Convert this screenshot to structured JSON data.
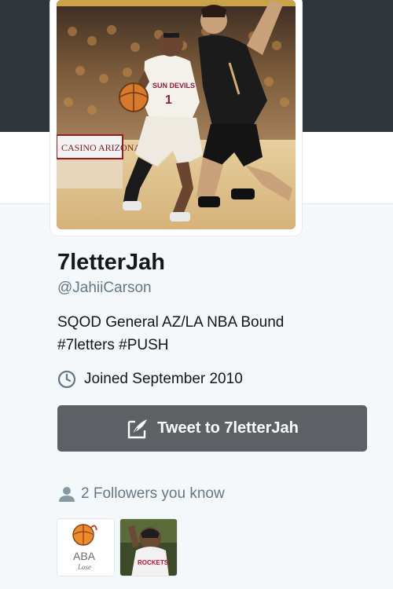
{
  "profile": {
    "name": "7letterJah",
    "handle": "@JahiiCarson",
    "bio_lines": [
      "SQOD General AZ/LA NBA Bound",
      "#7letters #PUSH"
    ],
    "joined": "Joined September 2010"
  },
  "avatar": {
    "jersey_text": "SUN DEVILS",
    "jersey_number": "1",
    "ad_text": "CASINO ARIZONA"
  },
  "tweet_button": {
    "label": "Tweet to 7letterJah"
  },
  "followers_you_know": {
    "text": "2 Followers you know",
    "items": [
      {
        "logo_text": "ABA",
        "logo_subtext": "Lose"
      },
      {
        "jersey_text": "ROCKETS"
      }
    ]
  },
  "colors": {
    "banner": "#30373c",
    "tweet_button": "#5d6166",
    "muted_text": "#657786",
    "primary_text": "#14171a"
  },
  "icons": {
    "joined": "clock-icon",
    "tweet": "quill-compose-icon",
    "followers": "person-icon"
  }
}
